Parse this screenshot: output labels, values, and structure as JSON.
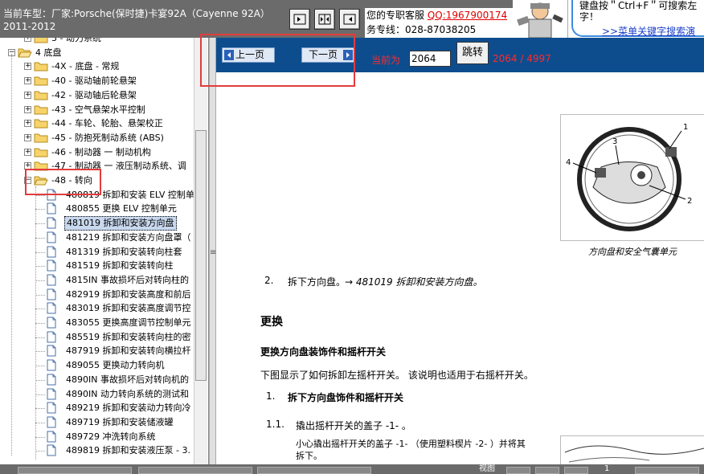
{
  "header": {
    "car_title": "当前车型：厂家:Porsche(保时捷)卡宴92A（Cayenne 92A）2011-2012",
    "support_label": "您的专职客服",
    "qq": "QQ:1967900174",
    "hotline": "务专线：028-87038205",
    "hint_text": "键盘按＂Ctrl+F＂可搜索左字！",
    "hint_link": ">>菜单关键字搜索演示"
  },
  "tree": {
    "items": [
      {
        "label": "3 - 动力系统",
        "level": 1,
        "type": "folder",
        "expanded": false
      },
      {
        "label": "4 底盘",
        "level": 0,
        "type": "folder",
        "expanded": true
      },
      {
        "label": "-4X - 底盘 - 常规",
        "level": 1,
        "type": "folder",
        "expanded": false
      },
      {
        "label": "-40 - 驱动轴前轮悬架",
        "level": 1,
        "type": "folder",
        "expanded": false
      },
      {
        "label": "-42 - 驱动轴后轮悬架",
        "level": 1,
        "type": "folder",
        "expanded": false
      },
      {
        "label": "-43 - 空气悬架水平控制",
        "level": 1,
        "type": "folder",
        "expanded": false
      },
      {
        "label": "-44 - 车轮、轮胎、悬架校正",
        "level": 1,
        "type": "folder",
        "expanded": false
      },
      {
        "label": "-45 - 防抱死制动系统 (ABS)",
        "level": 1,
        "type": "folder",
        "expanded": false
      },
      {
        "label": "-46 - 制动器 一 制动机构",
        "level": 1,
        "type": "folder",
        "expanded": false
      },
      {
        "label": "-47 - 制动器 一 液压制动系统、调",
        "level": 1,
        "type": "folder",
        "expanded": false
      },
      {
        "label": "-48 - 转向",
        "level": 1,
        "type": "folder",
        "expanded": true
      },
      {
        "label": "480819 拆卸和安装 ELV 控制单",
        "level": 2,
        "type": "doc"
      },
      {
        "label": "480855 更换 ELV 控制单元",
        "level": 2,
        "type": "doc"
      },
      {
        "label": "481019 拆卸和安装方向盘",
        "level": 2,
        "type": "doc",
        "selected": true
      },
      {
        "label": "481219 拆卸和安装方向盘罩（",
        "level": 2,
        "type": "doc"
      },
      {
        "label": "481319 拆卸和安装转向柱套",
        "level": 2,
        "type": "doc"
      },
      {
        "label": "481519 拆卸和安装转向柱",
        "level": 2,
        "type": "doc"
      },
      {
        "label": "4815IN 事故损坏后对转向柱的",
        "level": 2,
        "type": "doc"
      },
      {
        "label": "482919 拆卸和安装高度和前后",
        "level": 2,
        "type": "doc"
      },
      {
        "label": "483019 拆卸和安装高度调节控",
        "level": 2,
        "type": "doc"
      },
      {
        "label": "483055 更换高度调节控制单元",
        "level": 2,
        "type": "doc"
      },
      {
        "label": "485519 拆卸和安装转向柱的密",
        "level": 2,
        "type": "doc"
      },
      {
        "label": "487919 拆卸和安装转向横拉杆",
        "level": 2,
        "type": "doc"
      },
      {
        "label": "489055 更换动力转向机",
        "level": 2,
        "type": "doc"
      },
      {
        "label": "4890IN 事故损坏后对转向机的",
        "level": 2,
        "type": "doc"
      },
      {
        "label": "4890IN 动力转向系统的测试和",
        "level": 2,
        "type": "doc"
      },
      {
        "label": "489219 拆卸和安装动力转向冷",
        "level": 2,
        "type": "doc"
      },
      {
        "label": "489719 拆卸和安装储液罐",
        "level": 2,
        "type": "doc"
      },
      {
        "label": "489729 冲洗转向系统",
        "level": 2,
        "type": "doc"
      },
      {
        "label": "489819 拆卸和安装液压泵 - 3.",
        "level": 2,
        "type": "doc"
      }
    ]
  },
  "nav": {
    "prev_label": "上一页",
    "next_label": "下一页",
    "current_label": "当前为",
    "page_value": "2064",
    "jump_label": "跳转",
    "page_count": "2064 / 4997"
  },
  "document": {
    "figure1_caption": "方向盘和安全气囊单元",
    "figure1_labels": [
      "1",
      "2",
      "3",
      "4"
    ],
    "step2_num": "2.",
    "step2_text": "拆下方向盘。",
    "step2_ref": "→ 481019 拆卸和安装方向盘。",
    "section_heading": "更换",
    "subsection_heading": "更换方向盘装饰件和摇杆开关",
    "intro_text": "下图显示了如何拆卸左摇杆开关。 该说明也适用于右摇杆开关。",
    "step1_num": "1.",
    "step1_text": "拆下方向盘饰件和摇杆开关",
    "step11_num": "1.1.",
    "step11_text": "撬出摇杆开关的盖子 -1- 。",
    "step11_detail_line1": "小心撬出摇杆开关的盖子 -1- （使用塑料楔片 -2- ）并将其",
    "step11_detail_line2": "拆下。"
  },
  "status": {
    "view_label": "视图",
    "number": "1"
  }
}
